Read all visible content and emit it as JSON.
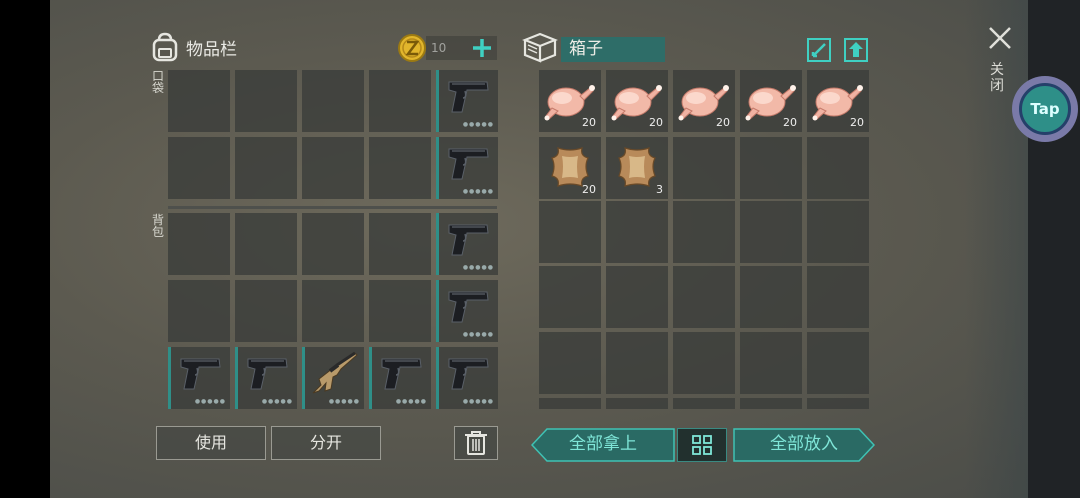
{
  "inventory": {
    "title": "物品栏",
    "coins": "10",
    "pocket_label": "口袋",
    "backpack_label": "背包",
    "use_button": "使用",
    "split_button": "分开"
  },
  "container": {
    "title": "箱子",
    "take_all_button": "全部拿上",
    "put_all_button": "全部放入",
    "items": [
      {
        "name": "raw-chicken",
        "qty": "20"
      },
      {
        "name": "raw-chicken",
        "qty": "20"
      },
      {
        "name": "raw-chicken",
        "qty": "20"
      },
      {
        "name": "raw-chicken",
        "qty": "20"
      },
      {
        "name": "raw-chicken",
        "qty": "20"
      },
      {
        "name": "animal-hide",
        "qty": "20"
      },
      {
        "name": "animal-hide",
        "qty": "3"
      }
    ]
  },
  "close_label": "关闭",
  "tap_button": "Tap",
  "colors": {
    "accent": "#2f8f88",
    "teal_text": "#7fe6d8",
    "panel": "#3a3c3a"
  }
}
